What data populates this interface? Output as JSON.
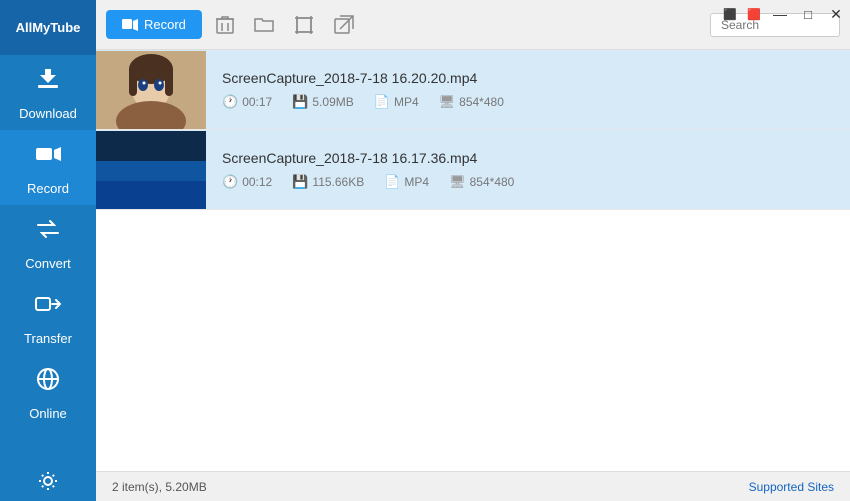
{
  "app": {
    "name": "AllMyTube",
    "logo_line1": "AllMyTube"
  },
  "window_controls": {
    "icon1": "🎮",
    "minimize": "—",
    "maximize": "□",
    "close": "✕"
  },
  "sidebar": {
    "items": [
      {
        "id": "download",
        "label": "Download",
        "icon": "⬇"
      },
      {
        "id": "record",
        "label": "Record",
        "icon": "⏺",
        "active": true
      },
      {
        "id": "convert",
        "label": "Convert",
        "icon": "↔"
      },
      {
        "id": "transfer",
        "label": "Transfer",
        "icon": "➡"
      },
      {
        "id": "online",
        "label": "Online",
        "icon": "🌐"
      }
    ]
  },
  "toolbar": {
    "record_label": "Record",
    "search_placeholder": "Search"
  },
  "files": [
    {
      "name": "ScreenCapture_2018-7-18 16.20.20.mp4",
      "duration": "00:17",
      "size": "5.09MB",
      "format": "MP4",
      "resolution": "854*480",
      "thumb_type": "anime"
    },
    {
      "name": "ScreenCapture_2018-7-18 16.17.36.mp4",
      "duration": "00:12",
      "size": "115.66KB",
      "format": "MP4",
      "resolution": "854*480",
      "thumb_type": "blue"
    }
  ],
  "statusbar": {
    "count_text": "2 item(s), 5.20MB",
    "supported_sites": "Supported Sites"
  }
}
